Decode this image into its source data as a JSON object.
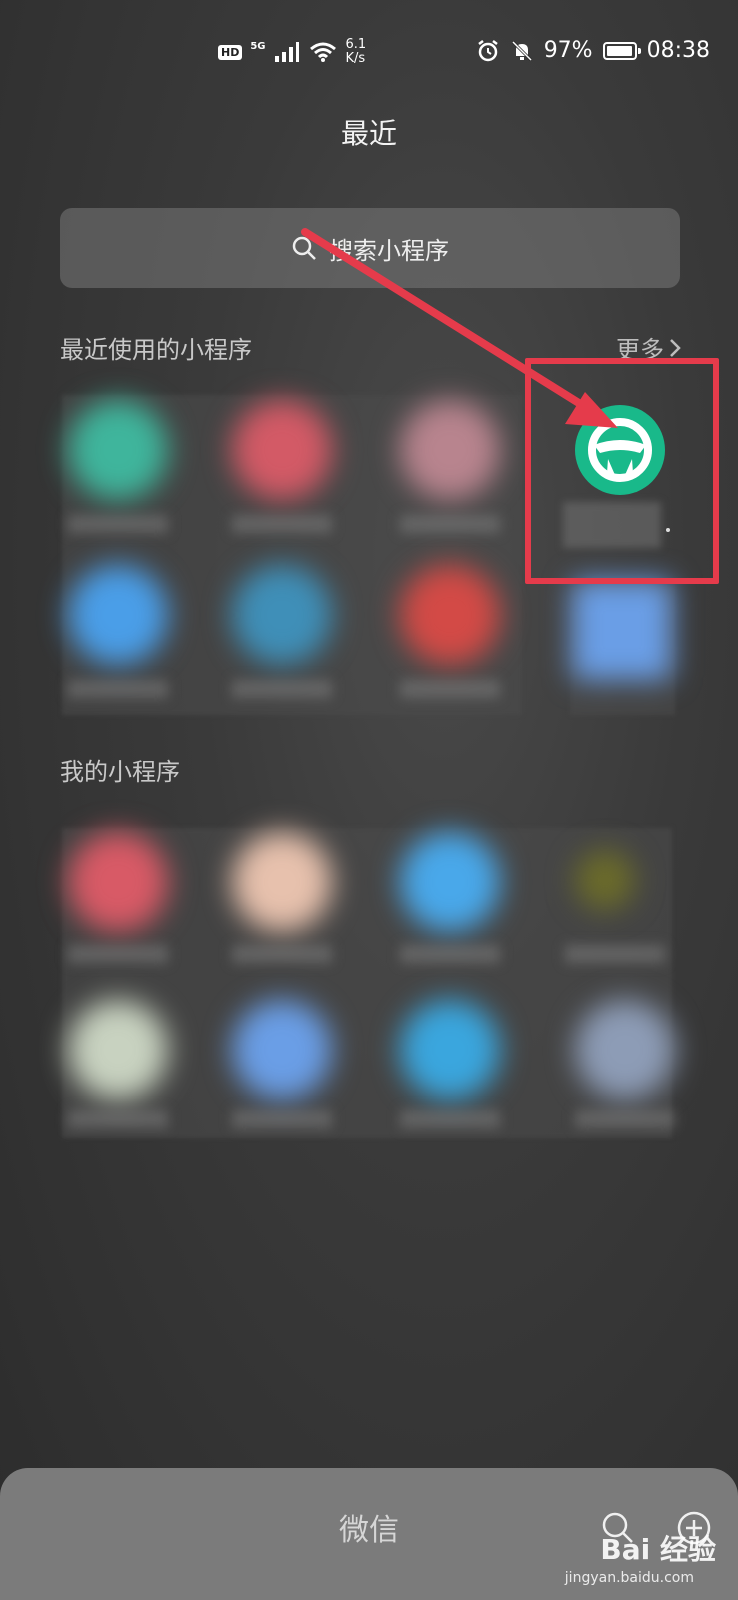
{
  "status_bar": {
    "hd": "HD",
    "network": "5G",
    "speed_value": "6.1",
    "speed_unit": "K/s",
    "battery_percent": "97%",
    "battery_level": 0.97,
    "time": "08:38"
  },
  "header": {
    "title": "最近"
  },
  "search": {
    "placeholder": "搜索小程序"
  },
  "recent_section": {
    "title": "最近使用的小程序",
    "more_label": "更多"
  },
  "my_section": {
    "title": "我的小程序"
  },
  "bottom_bar": {
    "title": "微信"
  },
  "watermark": {
    "brand": "Bai 经验",
    "url": "jingyan.baidu.com"
  },
  "colors": {
    "highlight": "#e53b4b",
    "app_icon": "#19b98a"
  },
  "icons": {
    "search": "search-icon",
    "steering_wheel": "steering-wheel-icon",
    "alarm": "alarm-icon",
    "mute": "bell-mute-icon",
    "wifi": "wifi-icon"
  }
}
